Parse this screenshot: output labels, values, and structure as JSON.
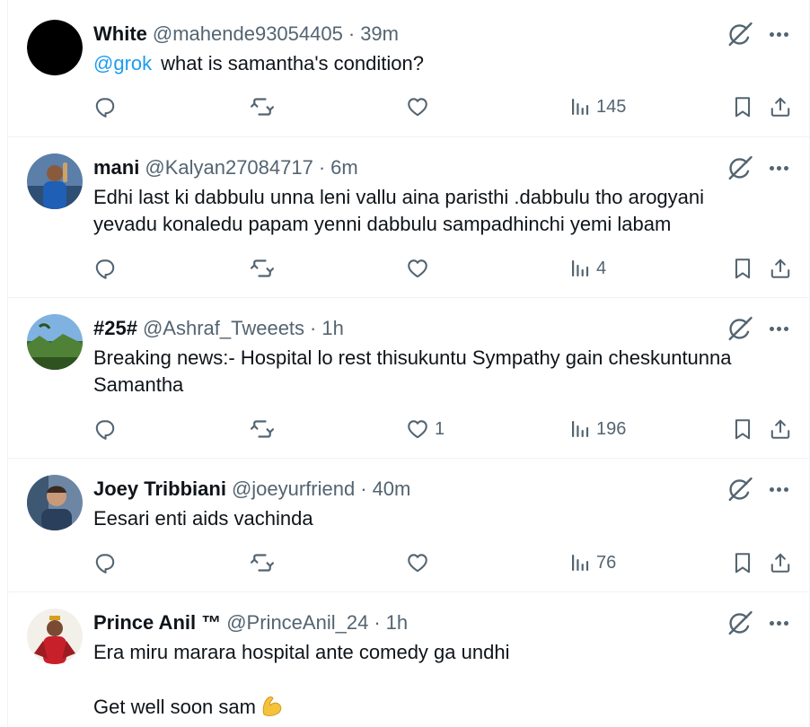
{
  "tweets": [
    {
      "name": "White",
      "handle": "@mahende93054405",
      "dot": "·",
      "time": "39m",
      "mention": "@grok",
      "lines": [
        "what is samantha's condition?"
      ],
      "likes": "",
      "views": "145",
      "avatar": "black-circle-avatar"
    },
    {
      "name": "mani",
      "handle": "@Kalyan27084717",
      "dot": "·",
      "time": "6m",
      "lines": [
        "Edhi last ki dabbulu unna leni vallu aina paristhi .dabbulu tho arogyani",
        "yevadu konaledu papam yenni dabbulu sampadhinchi yemi labam"
      ],
      "likes": "",
      "views": "4",
      "avatar": "cricketer-avatar"
    },
    {
      "name": "#25#",
      "handle": "@Ashraf_Tweeets",
      "dot": "·",
      "time": "1h",
      "lines": [
        "Breaking news:- Hospital lo rest thisukuntu Sympathy gain cheskuntunna",
        "Samantha"
      ],
      "likes": "1",
      "views": "196",
      "avatar": "landscape-avatar"
    },
    {
      "name": "Joey Tribbiani",
      "handle": "@joeyurfriend",
      "dot": "·",
      "time": "40m",
      "lines": [
        "Eesari enti aids vachinda"
      ],
      "likes": "",
      "views": "76",
      "avatar": "person-avatar"
    },
    {
      "name": "Prince Anil ™",
      "handle": "@PrinceAnil_24",
      "dot": "·",
      "time": "1h",
      "lines": [
        "Era miru marara hospital ante comedy ga undhi"
      ],
      "extra_line": "Get well soon sam",
      "emoji": "flexed-biceps-emoji",
      "avatar": "red-jersey-avatar"
    }
  ],
  "colors": {
    "text": "#0f1419",
    "secondary": "#536471",
    "accent": "#1d9bf0",
    "border": "#eff3f4"
  },
  "icons": [
    "grok-icon",
    "more-icon",
    "reply-icon",
    "retweet-icon",
    "like-icon",
    "views-icon",
    "bookmark-icon",
    "share-icon"
  ]
}
